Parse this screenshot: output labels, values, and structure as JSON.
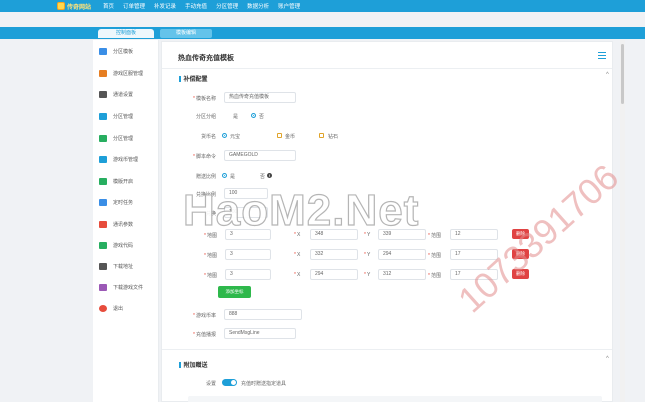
{
  "brand": {
    "logo_text": "传奇网站"
  },
  "top_nav": [
    "首页",
    "订单管理",
    "补发记录",
    "手动充值",
    "分区管理",
    "数据分析",
    "账户管理"
  ],
  "tabs": {
    "active": "控制面板",
    "second": "模板编辑"
  },
  "sidebar": {
    "items": [
      {
        "label": "分区模板",
        "color": "#3a8ee6"
      },
      {
        "label": "游戏区服管理",
        "color": "#e67e22"
      },
      {
        "label": "通道设置",
        "color": "#555555"
      },
      {
        "label": "分区管理",
        "color": "#1e9fd8"
      },
      {
        "label": "分区管理",
        "color": "#27ae60"
      },
      {
        "label": "游戏币管理",
        "color": "#1e9fd8"
      },
      {
        "label": "模版开启",
        "color": "#27ae60"
      },
      {
        "label": "定时任务",
        "color": "#3a8ee6"
      },
      {
        "label": "通讯参数",
        "color": "#e74c3c"
      },
      {
        "label": "游戏代码",
        "color": "#27ae60"
      },
      {
        "label": "下载地址",
        "color": "#555555"
      },
      {
        "label": "下载游戏文件",
        "color": "#9b59b6"
      },
      {
        "label": "退出",
        "color": "#e74c3c"
      }
    ]
  },
  "panel": {
    "title": "热血传奇充值模板",
    "section1": "补偿配置",
    "section2": "附加赠送",
    "fields": {
      "template_name": {
        "label": "模板名称",
        "value": "热血传奇充值模板"
      },
      "group_label": "分区分组",
      "group_opt1": "是",
      "group_opt2": "否",
      "currency_label": "货币名",
      "currency_opt1": "元宝",
      "currency_opt2": "金币",
      "currency_opt3": "钻石",
      "cmd_label": "脚本命令",
      "cmd_value": "GAMEGOLD",
      "scale_label": "赠送比例",
      "scale_opt1": "是",
      "scale_opt2": "否",
      "rate_label": "兑换比例",
      "rate_value": "100",
      "rate_label2": "兑换",
      "rate_value2": "100",
      "map_label": "地图",
      "x_label": "X",
      "y_label": "Y",
      "range_label": "范围",
      "del_label": "删除",
      "add_label": "添加坐标",
      "game_rate_label": "游戏币率",
      "game_rate_value": "888",
      "announce_label": "充值播报",
      "announce_value": "SendMsgLine",
      "gift_label": "设置",
      "gift_text": "充值时赠送指定道具"
    },
    "rows": [
      {
        "map": "3",
        "x": "348",
        "y": "339",
        "r": "12"
      },
      {
        "map": "3",
        "x": "332",
        "y": "294",
        "r": "17"
      },
      {
        "map": "3",
        "x": "294",
        "y": "312",
        "r": "17"
      }
    ]
  },
  "watermark": {
    "main": "HaoM2.Net",
    "phone": "1073391706"
  }
}
